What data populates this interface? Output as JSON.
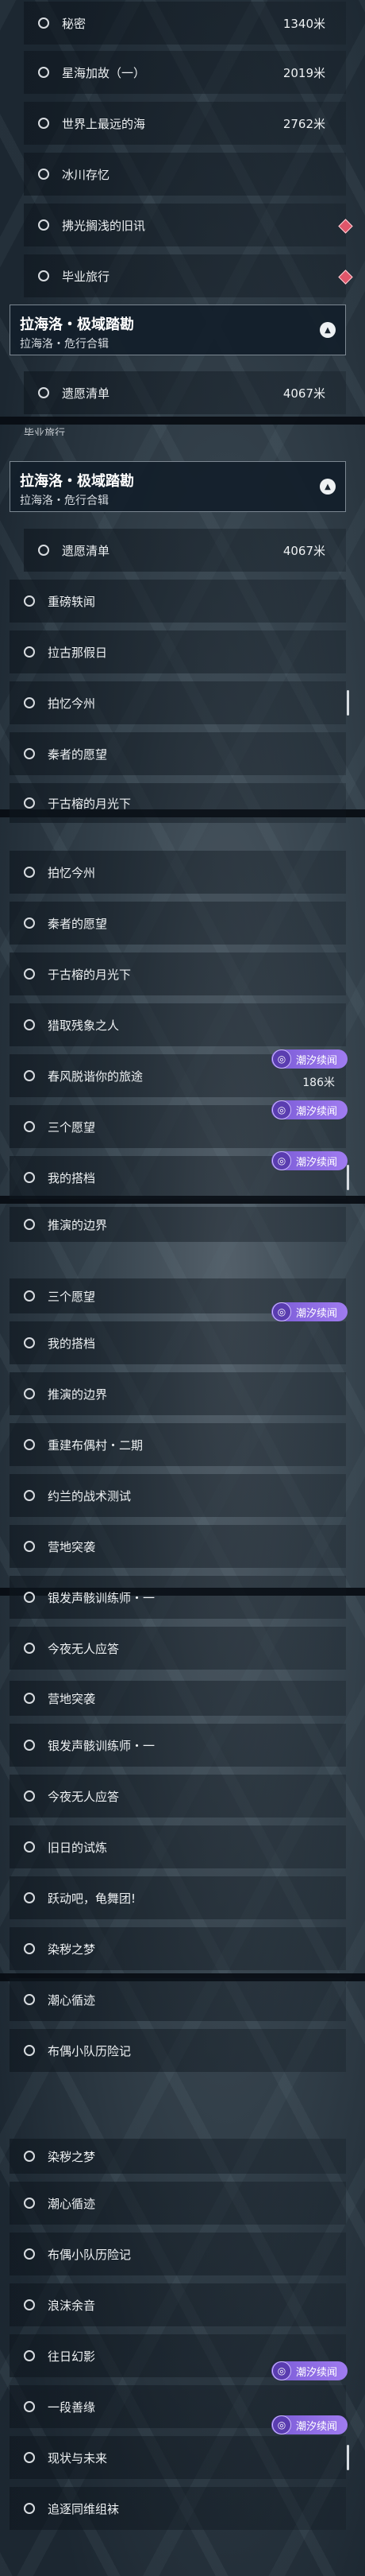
{
  "banner_icon": "purple-spiral-icon",
  "banner_label": "潮汐续闻",
  "group": {
    "title": "拉海洛・极域踏勘",
    "subtitle": "拉海洛・危行合辑"
  },
  "s1": [
    {
      "label": "秘密",
      "dist": "1340米"
    },
    {
      "label": "星海加故（一）",
      "dist": "2019米"
    },
    {
      "label": "世界上最远的海",
      "dist": "2762米"
    },
    {
      "label": "冰川存忆"
    },
    {
      "label": "拂光搁浅的旧讯"
    },
    {
      "label": "毕业旅行"
    }
  ],
  "wish": {
    "label": "遗愿清单",
    "dist": "4067米"
  },
  "frag_label": "毕业旅行",
  "s3": [
    "重磅轶闻",
    "拉古那假日",
    "拍忆今州",
    "秦者的愿望",
    "于古榕的月光下"
  ],
  "s4": [
    {
      "label": "拍忆今州"
    },
    {
      "label": "秦者的愿望"
    },
    {
      "label": "于古榕的月光下"
    },
    {
      "label": "猎取残象之人"
    },
    {
      "label": "春风脱谐你的旅途",
      "dist": "186米"
    },
    {
      "label": "三个愿望"
    },
    {
      "label": "我的搭档"
    },
    {
      "label": "推演的边界"
    }
  ],
  "s5": [
    "三个愿望",
    "我的搭档",
    "推演的边界",
    "重建布偶村・二期",
    "约兰的战术测试",
    "营地突袭",
    "银发声骸训练师・一",
    "今夜无人应答"
  ],
  "s6": [
    "营地突袭",
    "银发声骸训练师・一",
    "今夜无人应答",
    "旧日的试炼",
    "跃动吧，龟舞团!",
    "染秽之梦",
    "潮心循迹",
    "布偶小队历险记"
  ],
  "s7": [
    "染秽之梦",
    "潮心循迹",
    "布偶小队历险记",
    "浪沫余音",
    "往日幻影",
    "一段善缘",
    "现状与未来",
    "追逐同维组袜"
  ]
}
